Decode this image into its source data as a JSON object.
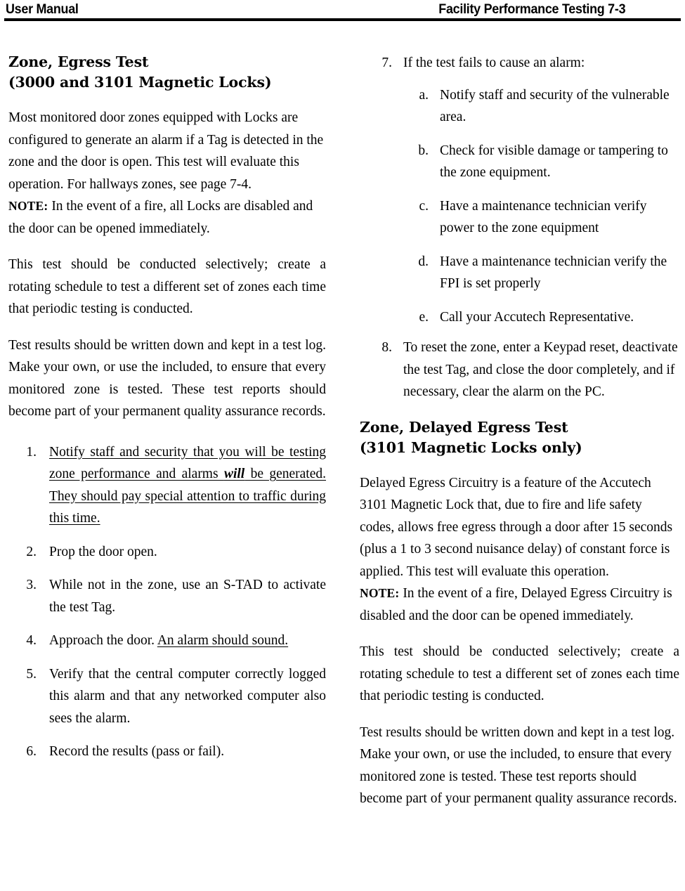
{
  "header": {
    "left": "User Manual",
    "right": "Facility Performance Testing 7-3"
  },
  "left_column": {
    "heading_line1": "Zone, Egress Test",
    "heading_line2": "(3000 and 3101 Magnetic Locks)",
    "para1": "Most monitored door zones equipped with Locks are configured to generate an alarm if a Tag is detected in the zone and the door is open. This test will evaluate this operation. For hallways zones, see page 7-4.",
    "note_label": "NOTE:",
    "note_text": " In the event of a fire, all Locks are disabled and the door can be opened immediately.",
    "para2": "This test should be conducted selectively; create a rotating schedule to test a different set of zones each time that periodic testing is conducted.",
    "para3": "Test results should be written down and kept in a test log.  Make your own, or use the included, to ensure that every monitored zone is tested. These test reports should become part of your permanent quality assurance records.",
    "steps": [
      {
        "marker": "1.",
        "underlined": true,
        "text_before_emphasis": "Notify staff and security that you will be testing zone performance and alarms ",
        "emphasis": "will",
        "text_after_emphasis": " be generated. They should pay special attention to traffic during this time."
      },
      {
        "marker": "2.",
        "underlined": false,
        "text": "Prop the door open."
      },
      {
        "marker": "3.",
        "underlined": false,
        "text": "While not in the zone, use an S-TAD to activate the test Tag."
      },
      {
        "marker": "4.",
        "underlined": false,
        "text_plain": "Approach the door. ",
        "text_underlined": "An alarm should sound."
      },
      {
        "marker": "5.",
        "underlined": false,
        "text": "Verify that the central computer correctly logged this alarm and that any networked computer also sees the alarm."
      },
      {
        "marker": "6.",
        "underlined": false,
        "text": "Record the results (pass or fail)."
      }
    ]
  },
  "right_column": {
    "step7": {
      "marker": "7.",
      "text": "If the test fails to cause an alarm:",
      "substeps": [
        {
          "marker": "a.",
          "text": "Notify staff and security of the vulnerable area."
        },
        {
          "marker": "b.",
          "text": "Check for visible damage or tampering to the zone equipment."
        },
        {
          "marker": "c.",
          "text": "Have a maintenance technician verify power to the zone equipment"
        },
        {
          "marker": "d.",
          "text": "Have a maintenance technician verify the FPI is set properly"
        },
        {
          "marker": "e.",
          "text": "Call your Accutech Representative."
        }
      ]
    },
    "step8": {
      "marker": "8.",
      "text": "To reset the zone, enter a Keypad reset, deactivate the test Tag, and close the door completely, and if necessary, clear the alarm on the PC."
    },
    "heading_line1": "Zone, Delayed Egress Test",
    "heading_line2": "(3101 Magnetic Locks only)",
    "para1": "Delayed Egress Circuitry is a feature of the Accutech 3101 Magnetic Lock that, due to fire and life safety codes, allows free egress through a door after 15 seconds (plus a 1 to 3 second nuisance delay) of constant force is applied. This test will evaluate this operation.",
    "note_label": "NOTE:",
    "note_text": " In the event of a fire, Delayed Egress Circuitry is disabled and the door can be opened immediately.",
    "para2": "This test should be conducted selectively; create a rotating schedule to test a different set of zones each time that periodic testing is conducted.",
    "para3": "Test results should be written down and kept in a test log.  Make your own, or use the included, to ensure that every monitored zone is tested. These test reports should become part of your permanent quality assurance records."
  }
}
